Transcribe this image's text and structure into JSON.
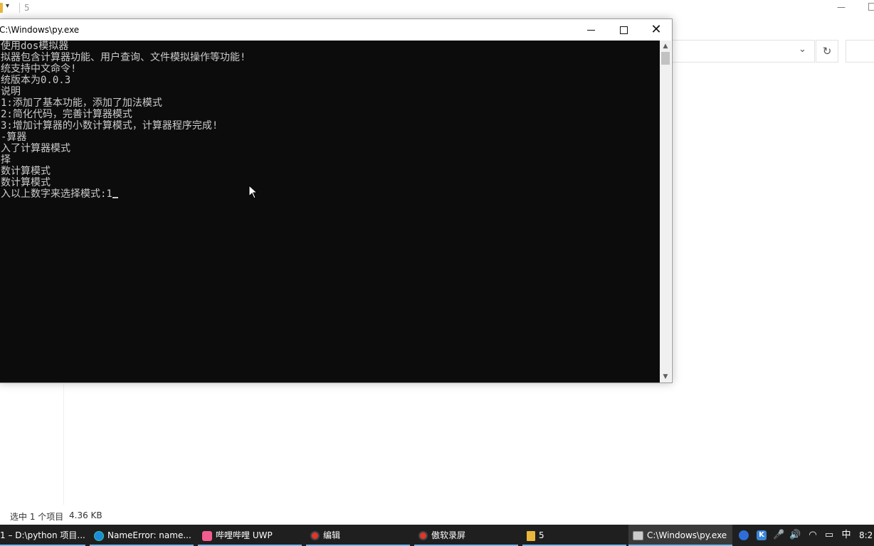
{
  "explorer": {
    "quick_access_glyph": "▾",
    "title": "5",
    "minimize_glyph": "—",
    "refresh_glyph": "↻",
    "address_chevron": "⌄",
    "status": {
      "selection": "选中 1 个项目",
      "size": "4.36 KB"
    }
  },
  "console": {
    "title": "C:\\Windows\\py.exe",
    "close_glyph": "✕",
    "lines": [
      "使用dos模拟器",
      "拟器包含计算器功能、用户查询、文件模拟操作等功能!",
      "统支持中文命令!",
      "统版本为0.0.3",
      "说明",
      "1:添加了基本功能，添加了加法模式",
      "2:简化代码，完善计算器模式",
      "3:增加计算器的小数计算模式，计算器程序完成!",
      "-算器",
      "入了计算器模式",
      "择",
      "数计算模式",
      "数计算模式",
      "入以上数字来选择模式:1"
    ],
    "scroll_up": "▲",
    "scroll_down": "▼"
  },
  "taskbar": {
    "items": [
      {
        "label": "1 – D:\\python 项目...",
        "icon": "pycharm-icon"
      },
      {
        "label": "NameError: name...",
        "icon": "edge-icon"
      },
      {
        "label": "哔哩哔哩 UWP",
        "icon": "bilibili-icon"
      },
      {
        "label": "编辑",
        "icon": "record-icon"
      },
      {
        "label": "傲软录屏",
        "icon": "record-icon"
      },
      {
        "label": "5",
        "icon": "folder-icon"
      },
      {
        "label": "C:\\Windows\\py.exe",
        "icon": "console-icon"
      }
    ],
    "tray": {
      "k_label": "K",
      "mic_glyph": "🎤",
      "speaker_glyph": "🔊",
      "wifi_glyph": "◠",
      "battery_glyph": "▭",
      "ime_label": "中",
      "clock": "8:2"
    }
  }
}
